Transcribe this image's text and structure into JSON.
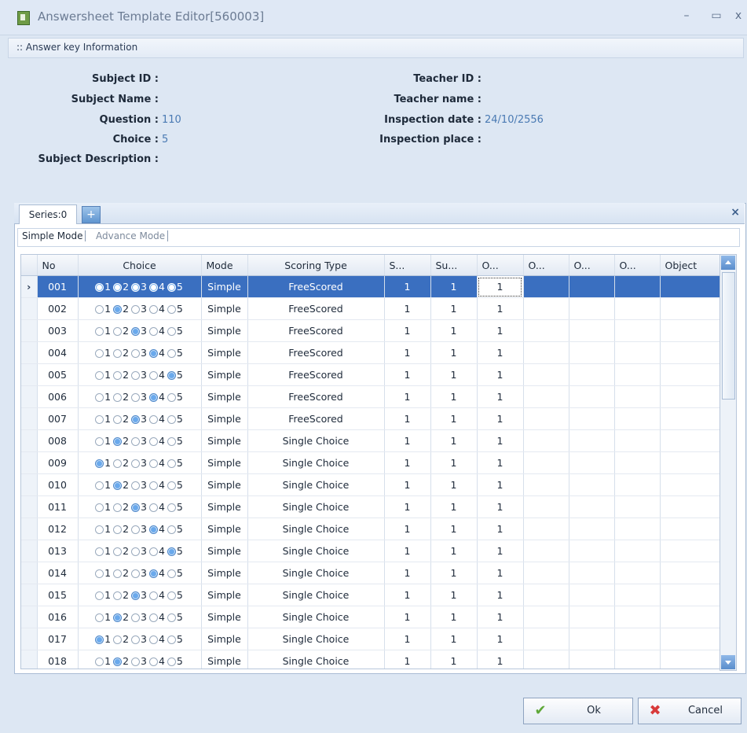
{
  "window": {
    "title": "Answersheet Template Editor[560003]",
    "minimize": "–",
    "maximize": "▭",
    "close": "x"
  },
  "section": {
    "title": ":: Answer key Information"
  },
  "info": {
    "subject_id_label": "Subject ID :",
    "subject_id": "",
    "subject_name_label": "Subject Name :",
    "subject_name": "",
    "question_label": "Question :",
    "question": "110",
    "choice_label": "Choice :",
    "choice": "5",
    "subject_desc_label": "Subject Description :",
    "teacher_id_label": "Teacher ID :",
    "teacher_id": "",
    "teacher_name_label": "Teacher name :",
    "teacher_name": "",
    "inspection_date_label": "Inspection date :",
    "inspection_date": "24/10/2556",
    "inspection_place_label": "Inspection place :",
    "inspection_place": ""
  },
  "tabs": {
    "series": "Series:0",
    "add": "+",
    "close": "×"
  },
  "modes": {
    "simple": "Simple Mode",
    "advance": "Advance Mode"
  },
  "grid": {
    "columns": [
      "No",
      "Choice",
      "Mode",
      "Scoring Type",
      "S...",
      "Su...",
      "O...",
      "O...",
      "O...",
      "O...",
      "Object"
    ],
    "selected_row": 0,
    "choice_labels": [
      "1",
      "2",
      "3",
      "4",
      "5"
    ],
    "rows": [
      {
        "no": "001",
        "sel": [
          1,
          1,
          1,
          1,
          1
        ],
        "mode": "Simple",
        "type": "FreeScored",
        "s": "1",
        "su": "1",
        "o": "1"
      },
      {
        "no": "002",
        "sel": [
          0,
          1,
          0,
          0,
          0
        ],
        "mode": "Simple",
        "type": "FreeScored",
        "s": "1",
        "su": "1",
        "o": "1"
      },
      {
        "no": "003",
        "sel": [
          0,
          0,
          1,
          0,
          0
        ],
        "mode": "Simple",
        "type": "FreeScored",
        "s": "1",
        "su": "1",
        "o": "1"
      },
      {
        "no": "004",
        "sel": [
          0,
          0,
          0,
          1,
          0
        ],
        "mode": "Simple",
        "type": "FreeScored",
        "s": "1",
        "su": "1",
        "o": "1"
      },
      {
        "no": "005",
        "sel": [
          0,
          0,
          0,
          0,
          1
        ],
        "mode": "Simple",
        "type": "FreeScored",
        "s": "1",
        "su": "1",
        "o": "1"
      },
      {
        "no": "006",
        "sel": [
          0,
          0,
          0,
          1,
          0
        ],
        "mode": "Simple",
        "type": "FreeScored",
        "s": "1",
        "su": "1",
        "o": "1"
      },
      {
        "no": "007",
        "sel": [
          0,
          0,
          1,
          0,
          0
        ],
        "mode": "Simple",
        "type": "FreeScored",
        "s": "1",
        "su": "1",
        "o": "1"
      },
      {
        "no": "008",
        "sel": [
          0,
          1,
          0,
          0,
          0
        ],
        "mode": "Simple",
        "type": "Single Choice",
        "s": "1",
        "su": "1",
        "o": "1"
      },
      {
        "no": "009",
        "sel": [
          1,
          0,
          0,
          0,
          0
        ],
        "mode": "Simple",
        "type": "Single Choice",
        "s": "1",
        "su": "1",
        "o": "1"
      },
      {
        "no": "010",
        "sel": [
          0,
          1,
          0,
          0,
          0
        ],
        "mode": "Simple",
        "type": "Single Choice",
        "s": "1",
        "su": "1",
        "o": "1"
      },
      {
        "no": "011",
        "sel": [
          0,
          0,
          1,
          0,
          0
        ],
        "mode": "Simple",
        "type": "Single Choice",
        "s": "1",
        "su": "1",
        "o": "1"
      },
      {
        "no": "012",
        "sel": [
          0,
          0,
          0,
          1,
          0
        ],
        "mode": "Simple",
        "type": "Single Choice",
        "s": "1",
        "su": "1",
        "o": "1"
      },
      {
        "no": "013",
        "sel": [
          0,
          0,
          0,
          0,
          1
        ],
        "mode": "Simple",
        "type": "Single Choice",
        "s": "1",
        "su": "1",
        "o": "1"
      },
      {
        "no": "014",
        "sel": [
          0,
          0,
          0,
          1,
          0
        ],
        "mode": "Simple",
        "type": "Single Choice",
        "s": "1",
        "su": "1",
        "o": "1"
      },
      {
        "no": "015",
        "sel": [
          0,
          0,
          1,
          0,
          0
        ],
        "mode": "Simple",
        "type": "Single Choice",
        "s": "1",
        "su": "1",
        "o": "1"
      },
      {
        "no": "016",
        "sel": [
          0,
          1,
          0,
          0,
          0
        ],
        "mode": "Simple",
        "type": "Single Choice",
        "s": "1",
        "su": "1",
        "o": "1"
      },
      {
        "no": "017",
        "sel": [
          1,
          0,
          0,
          0,
          0
        ],
        "mode": "Simple",
        "type": "Single Choice",
        "s": "1",
        "su": "1",
        "o": "1"
      },
      {
        "no": "018",
        "sel": [
          0,
          1,
          0,
          0,
          0
        ],
        "mode": "Simple",
        "type": "Single Choice",
        "s": "1",
        "su": "1",
        "o": "1"
      }
    ]
  },
  "buttons": {
    "ok": "Ok",
    "cancel": "Cancel",
    "ok_icon": "check-icon",
    "cancel_icon": "x-icon"
  },
  "colors": {
    "selection": "#3a6fc0",
    "value_text": "#4a7ab3",
    "window_bg": "#dde7f3"
  }
}
